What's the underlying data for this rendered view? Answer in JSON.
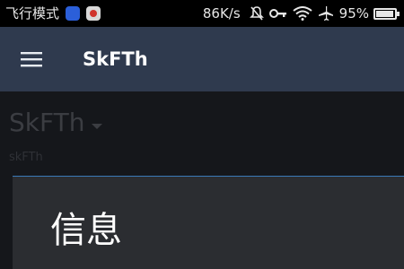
{
  "status_bar": {
    "mode_text": "飞行模式",
    "net_speed": "86K/s",
    "battery_percent": "95%",
    "battery_level": 0.95,
    "icons": [
      "app-icon",
      "app-icon",
      "mute-icon",
      "key-icon",
      "wifi-icon",
      "airplane-icon",
      "battery-icon"
    ]
  },
  "app_bar": {
    "title": "SkFTh",
    "menu_icon": "menu-icon",
    "background": "#2f3a4e"
  },
  "content": {
    "spinner_value": "SkFTh",
    "subtext": "skFTh"
  },
  "dialog": {
    "title": "信息",
    "accent": "#3a7ab8"
  }
}
